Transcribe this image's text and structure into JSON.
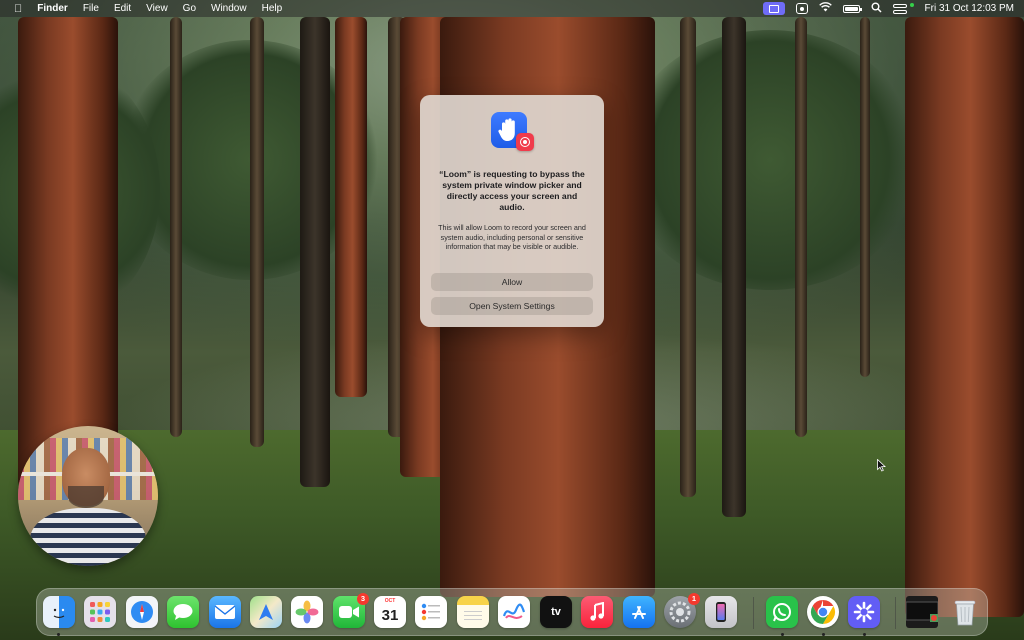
{
  "menubar": {
    "app_name": "Finder",
    "menus": [
      "File",
      "Edit",
      "View",
      "Go",
      "Window",
      "Help"
    ],
    "clock": "Fri 31 Oct  12:03 PM",
    "status_icons": [
      "loom-tray-icon",
      "screen-record-icon",
      "wifi-icon",
      "battery-icon",
      "search-icon",
      "control-center-icon"
    ]
  },
  "dialog": {
    "title": "“Loom” is requesting to bypass the system private window picker and directly access your screen and audio.",
    "body": "This will allow Loom to record your screen and system audio, including personal or sensitive information that may be visible or audible.",
    "allow_label": "Allow",
    "settings_label": "Open System Settings",
    "app_icon": "loom-hand-icon"
  },
  "dock": {
    "apps": [
      {
        "name": "Finder",
        "icon": "finder-icon"
      },
      {
        "name": "Launchpad",
        "icon": "launchpad-icon"
      },
      {
        "name": "Safari",
        "icon": "safari-icon"
      },
      {
        "name": "Messages",
        "icon": "messages-icon"
      },
      {
        "name": "Mail",
        "icon": "mail-icon"
      },
      {
        "name": "Maps",
        "icon": "maps-icon"
      },
      {
        "name": "Photos",
        "icon": "photos-icon"
      },
      {
        "name": "FaceTime",
        "icon": "facetime-icon",
        "badge": "3"
      },
      {
        "name": "Calendar",
        "icon": "calendar-icon",
        "month": "OCT",
        "day": "31"
      },
      {
        "name": "Reminders",
        "icon": "reminders-icon"
      },
      {
        "name": "Notes",
        "icon": "notes-icon"
      },
      {
        "name": "Freeform",
        "icon": "freeform-icon"
      },
      {
        "name": "TV",
        "icon": "tv-icon",
        "label": "tv"
      },
      {
        "name": "Music",
        "icon": "music-icon"
      },
      {
        "name": "App Store",
        "icon": "app-store-icon"
      },
      {
        "name": "System Settings",
        "icon": "system-settings-icon",
        "badge": "1"
      },
      {
        "name": "iPhone Mirroring",
        "icon": "iphone-mirroring-icon"
      },
      {
        "name": "WhatsApp",
        "icon": "whatsapp-icon"
      },
      {
        "name": "Chrome",
        "icon": "chrome-icon"
      },
      {
        "name": "Loom",
        "icon": "loom-icon"
      },
      {
        "name": "Downloads Stack",
        "icon": "stack-icon"
      },
      {
        "name": "Trash",
        "icon": "trash-icon"
      }
    ]
  }
}
